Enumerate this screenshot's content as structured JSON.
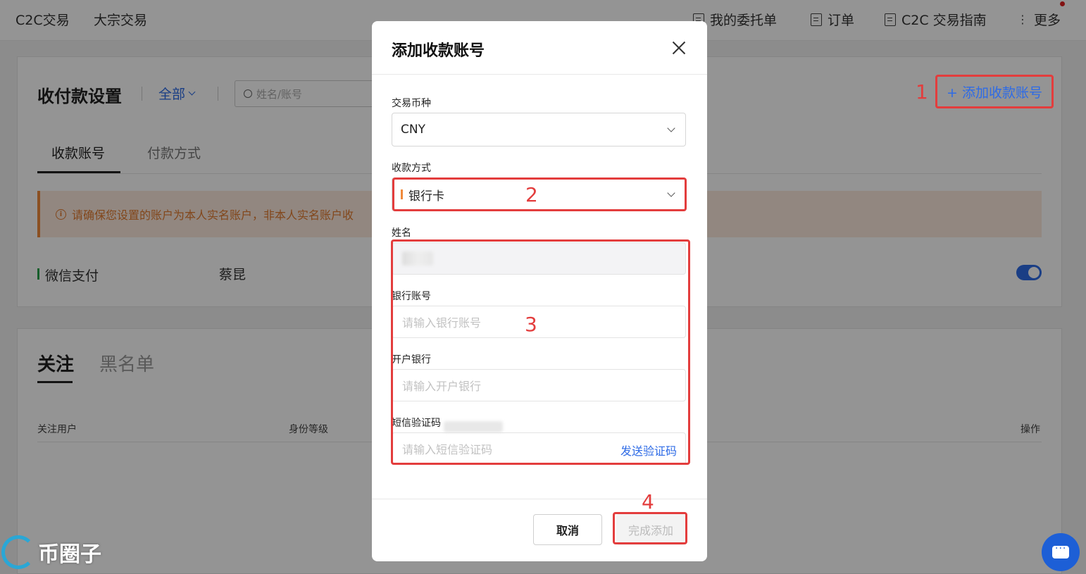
{
  "topnav": {
    "left_items": [
      "C2C交易",
      "大宗交易"
    ],
    "right_items": [
      {
        "icon": "orders-list-icon",
        "label": "我的委托单"
      },
      {
        "icon": "document-icon",
        "label": "订单"
      },
      {
        "icon": "book-icon",
        "label": "C2C 交易指南"
      },
      {
        "icon": "more-dots-icon",
        "label": "更多"
      }
    ]
  },
  "settings": {
    "title": "收付款设置",
    "filter_label": "全部",
    "search_placeholder": "姓名/账号",
    "tabs": [
      "收款账号",
      "付款方式"
    ],
    "notice": "请确保您设置的账户为本人实名账户，非本人实名账户收",
    "add_button": "+ 添加收款账号",
    "account_row": {
      "method": "微信支付",
      "name": "蔡昆",
      "enabled": true
    }
  },
  "follow": {
    "tabs": [
      "关注",
      "黑名单"
    ],
    "columns": [
      "关注用户",
      "身份等级",
      "操作"
    ]
  },
  "modal": {
    "title": "添加收款账号",
    "currency_label": "交易币种",
    "currency_value": "CNY",
    "method_label": "收款方式",
    "method_value": "银行卡",
    "name_label": "姓名",
    "bank_account_label": "银行账号",
    "bank_account_placeholder": "请输入银行账号",
    "bank_name_label": "开户银行",
    "bank_name_placeholder": "请输入开户银行",
    "sms_label": "短信验证码",
    "sms_placeholder": "请输入短信验证码",
    "send_code": "发送验证码",
    "cancel": "取消",
    "confirm": "完成添加"
  },
  "annotations": [
    "1",
    "2",
    "3",
    "4"
  ],
  "watermark": "币圈子",
  "colors": {
    "accent": "#2e6be6",
    "annotation": "#e33d3d",
    "warning_bg": "#fbe9dc",
    "warning_text": "#e07a30"
  }
}
